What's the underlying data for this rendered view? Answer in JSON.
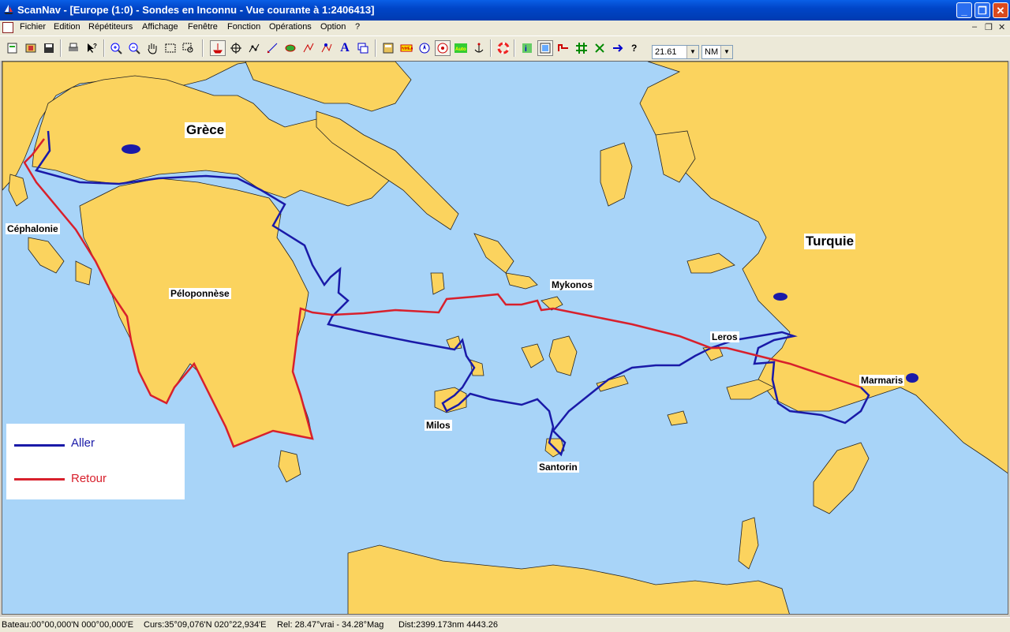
{
  "window": {
    "title": "ScanNav - [Europe (1:0) - Sondes en  Inconnu  - Vue courante à 1:2406413]",
    "minimize": "_",
    "restore": "❐",
    "close": "✕"
  },
  "menu": {
    "items": [
      "Fichier",
      "Edition",
      "Répétiteurs",
      "Affichage",
      "Fenêtre",
      "Fonction",
      "Opérations",
      "Option",
      "?"
    ],
    "mdi_min": "–",
    "mdi_restore": "❐",
    "mdi_close": "✕"
  },
  "toolbar": {
    "zoom_value": "21.61",
    "unit_value": "NM",
    "buttons": [
      "new",
      "open",
      "save",
      "print",
      "help",
      "zoom-in",
      "zoom-out",
      "pan",
      "select",
      "zoom-rect",
      "boat",
      "center",
      "route",
      "measure",
      "waypoint",
      "track",
      "edit",
      "text",
      "layers",
      "nmea-repeater",
      "nmea",
      "north-up",
      "course-up",
      "auto",
      "anchor",
      "mob",
      "info",
      "chart",
      "tide",
      "grid",
      "sail",
      "wind",
      "help2"
    ]
  },
  "map": {
    "labels": {
      "grece": "Grèce",
      "turquie": "Turquie",
      "cephalonie": "Céphalonie",
      "peloponnese": "Péloponnèse",
      "mykonos": "Mykonos",
      "leros": "Leros",
      "marmaris": "Marmaris",
      "milos": "Milos",
      "santorin": "Santorin"
    },
    "colors": {
      "sea": "#a8d4f8",
      "land": "#fbd35e",
      "aller": "#1a1aa8",
      "retour": "#d8202c"
    }
  },
  "legend": {
    "aller": "Aller",
    "retour": "Retour"
  },
  "status": {
    "bateau": "Bateau:00°00,000'N 000°00,000'E",
    "curs": "Curs:35°09,076'N 020°22,934'E",
    "rel": "Rel: 28.47°vrai - 34.28°Mag",
    "dist": "Dist:2399.173nm  4443.26"
  }
}
